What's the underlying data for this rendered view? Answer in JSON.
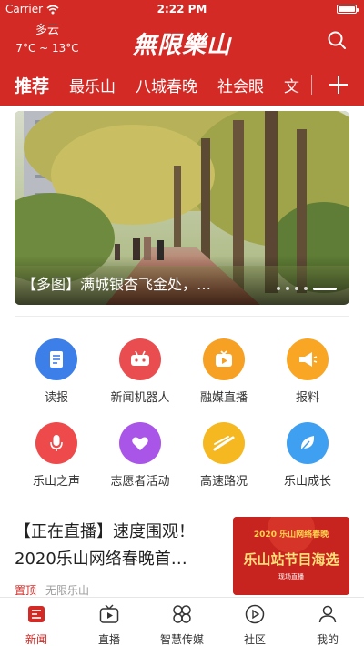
{
  "status_bar": {
    "carrier": "Carrier",
    "time": "2:22 PM"
  },
  "header": {
    "weather_condition": "多云",
    "temperature": "7°C ~ 13°C",
    "app_title": "無限樂山"
  },
  "tabs": [
    {
      "label": "推荐",
      "active": true
    },
    {
      "label": "最乐山",
      "active": false
    },
    {
      "label": "八城春晚",
      "active": false
    },
    {
      "label": "社会眼",
      "active": false
    },
    {
      "label": "文",
      "active": false
    }
  ],
  "banner": {
    "caption": "【多图】满城银杏飞金处，…",
    "slide_count": 5,
    "active_slide": 5
  },
  "services": [
    {
      "label": "读报",
      "icon": "newspaper-icon",
      "color": "#3d7fe8"
    },
    {
      "label": "新闻机器人",
      "icon": "robot-icon",
      "color": "#ea4d4f"
    },
    {
      "label": "融媒直播",
      "icon": "live-play-icon",
      "color": "#f6a024"
    },
    {
      "label": "报料",
      "icon": "megaphone-icon",
      "color": "#f8a623"
    },
    {
      "label": "乐山之声",
      "icon": "microphone-icon",
      "color": "#ee4a4b"
    },
    {
      "label": "志愿者活动",
      "icon": "heart-icon",
      "color": "#a955e8"
    },
    {
      "label": "高速路况",
      "icon": "road-icon",
      "color": "#f5b820"
    },
    {
      "label": "乐山成长",
      "icon": "leaf-icon",
      "color": "#3f9ff0"
    }
  ],
  "news": {
    "headline": "【正在直播】速度围观！2020乐山网络春晚首…",
    "pin_label": "置顶",
    "source": "无限乐山",
    "thumb_top": "2020 乐山网络春晚",
    "thumb_main": "乐山站节目海选",
    "thumb_sub": "现场直播"
  },
  "bottom_nav": [
    {
      "label": "新闻",
      "icon": "news-icon",
      "active": true
    },
    {
      "label": "直播",
      "icon": "tv-icon",
      "active": false
    },
    {
      "label": "智慧传媒",
      "icon": "grid-petals-icon",
      "active": false
    },
    {
      "label": "社区",
      "icon": "community-icon",
      "active": false
    },
    {
      "label": "我的",
      "icon": "profile-icon",
      "active": false
    }
  ],
  "colors": {
    "brand_red": "#d32a25",
    "divider": "#ececec",
    "muted": "#9a9a9a"
  }
}
